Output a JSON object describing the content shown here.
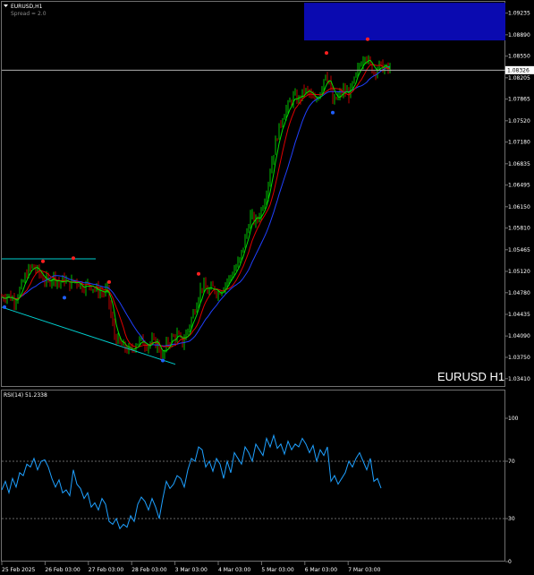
{
  "header": {
    "symbol_label": "EURUSD,H1",
    "spread_label": "Spread = 2.0"
  },
  "watermark": "EURUSD H1",
  "current_price_label": "1.08326",
  "colors": {
    "background": "#000000",
    "bull_candle": "#00c000",
    "bear_candle": "#c00000",
    "fast_ma": "#00e000",
    "mid_ma": "#e00000",
    "slow_ma": "#2040ff",
    "rsi": "#1ea0ff",
    "trendline": "#00d0d0",
    "supply_zone": "#0a0ab0",
    "fractal_up": "#ff2020",
    "fractal_down": "#2060ff"
  },
  "chart_data": [
    {
      "type": "candlestick",
      "symbol": "EURUSD",
      "timeframe": "H1",
      "y_ticks": [
        1.09235,
        1.0889,
        1.0855,
        1.08205,
        1.07865,
        1.0752,
        1.0718,
        1.06835,
        1.06495,
        1.0615,
        1.0581,
        1.05465,
        1.0512,
        1.0478,
        1.04435,
        1.0409,
        1.0375,
        1.0341
      ],
      "ylim": [
        1.0335,
        1.0933
      ],
      "current_price": 1.08326,
      "x_tick_labels": [
        "25 Feb 2025",
        "26 Feb 03:00",
        "27 Feb 03:00",
        "28 Feb 03:00",
        "3 Mar 03:00",
        "4 Mar 03:00",
        "5 Mar 03:00",
        "6 Mar 03:00",
        "7 Mar 03:00"
      ],
      "close_path": [
        [
          0,
          1.047
        ],
        [
          8,
          1.0475
        ],
        [
          16,
          1.0466
        ],
        [
          24,
          1.0488
        ],
        [
          30,
          1.051
        ],
        [
          36,
          1.052
        ],
        [
          42,
          1.0512
        ],
        [
          48,
          1.05
        ],
        [
          54,
          1.0495
        ],
        [
          60,
          1.0505
        ],
        [
          66,
          1.0492
        ],
        [
          72,
          1.05
        ],
        [
          76,
          1.049
        ],
        [
          84,
          1.0498
        ],
        [
          92,
          1.0488
        ],
        [
          100,
          1.0492
        ],
        [
          108,
          1.0482
        ],
        [
          116,
          1.0478
        ],
        [
          120,
          1.0482
        ],
        [
          124,
          1.044
        ],
        [
          128,
          1.041
        ],
        [
          134,
          1.0395
        ],
        [
          140,
          1.039
        ],
        [
          146,
          1.0384
        ],
        [
          152,
          1.0398
        ],
        [
          158,
          1.0402
        ],
        [
          164,
          1.0395
        ],
        [
          170,
          1.04
        ],
        [
          176,
          1.0396
        ],
        [
          182,
          1.0374
        ],
        [
          186,
          1.0395
        ],
        [
          192,
          1.0405
        ],
        [
          198,
          1.041
        ],
        [
          204,
          1.0398
        ],
        [
          210,
          1.042
        ],
        [
          216,
          1.0445
        ],
        [
          222,
          1.0475
        ],
        [
          226,
          1.049
        ],
        [
          232,
          1.048
        ],
        [
          238,
          1.0485
        ],
        [
          244,
          1.0478
        ],
        [
          250,
          1.049
        ],
        [
          256,
          1.05
        ],
        [
          262,
          1.0515
        ],
        [
          268,
          1.053
        ],
        [
          274,
          1.0565
        ],
        [
          280,
          1.06
        ],
        [
          286,
          1.059
        ],
        [
          292,
          1.061
        ],
        [
          298,
          1.064
        ],
        [
          304,
          1.069
        ],
        [
          310,
          1.073
        ],
        [
          316,
          1.076
        ],
        [
          322,
          1.0775
        ],
        [
          328,
          1.079
        ],
        [
          334,
          1.0785
        ],
        [
          340,
          1.08
        ],
        [
          346,
          1.0795
        ],
        [
          352,
          1.078
        ],
        [
          358,
          1.08
        ],
        [
          364,
          1.083
        ],
        [
          368,
          1.0815
        ],
        [
          372,
          1.078
        ],
        [
          378,
          1.079
        ],
        [
          384,
          1.08
        ],
        [
          390,
          1.0795
        ],
        [
          396,
          1.0815
        ],
        [
          402,
          1.084
        ],
        [
          408,
          1.086
        ],
        [
          412,
          1.0845
        ],
        [
          418,
          1.083
        ],
        [
          424,
          1.084
        ],
        [
          430,
          1.0835
        ],
        [
          436,
          1.0833
        ]
      ],
      "fractals_up": [
        [
          48,
          1.0528
        ],
        [
          82,
          1.0533
        ],
        [
          122,
          1.0495
        ],
        [
          222,
          1.0508
        ],
        [
          365,
          1.086
        ],
        [
          411,
          1.0882
        ]
      ],
      "fractals_down": [
        [
          5,
          1.0455
        ],
        [
          72,
          1.047
        ],
        [
          182,
          1.037
        ],
        [
          372,
          1.0765
        ]
      ],
      "channel_top": [
        [
          2,
          1.0532
        ],
        [
          107,
          1.0532
        ]
      ],
      "trendline": [
        [
          2,
          1.0455
        ],
        [
          196,
          1.0364
        ]
      ],
      "supply_zone": {
        "x": [
          340,
          565
        ],
        "y": [
          1.088,
          1.094
        ]
      }
    },
    {
      "type": "line",
      "title": "RSI(14) 51.2338",
      "ylim": [
        0,
        100
      ],
      "y_ticks": [
        100,
        70,
        30,
        0
      ],
      "levels": [
        70,
        30
      ],
      "x": [
        2,
        6,
        10,
        14,
        18,
        22,
        26,
        30,
        34,
        38,
        42,
        46,
        50,
        54,
        58,
        62,
        66,
        70,
        74,
        78,
        82,
        86,
        90,
        94,
        98,
        102,
        106,
        110,
        114,
        118,
        122,
        126,
        130,
        134,
        138,
        142,
        146,
        150,
        154,
        158,
        162,
        166,
        170,
        174,
        178,
        182,
        186,
        190,
        194,
        198,
        202,
        206,
        210,
        214,
        218,
        222,
        226,
        230,
        234,
        238,
        242,
        246,
        250,
        254,
        258,
        262,
        266,
        270,
        274,
        278,
        282,
        286,
        290,
        294,
        298,
        302,
        306,
        310,
        314,
        318,
        322,
        326,
        330,
        334,
        338,
        342,
        346,
        350,
        354,
        358,
        362,
        366,
        370,
        374,
        378,
        382,
        386,
        390,
        394,
        398,
        402,
        406,
        410,
        414,
        418,
        422,
        426
      ],
      "values": [
        50,
        56,
        48,
        58,
        52,
        62,
        60,
        68,
        66,
        72,
        64,
        70,
        71,
        66,
        58,
        52,
        57,
        48,
        50,
        46,
        64,
        54,
        51,
        44,
        48,
        38,
        41,
        36,
        44,
        40,
        28,
        26,
        30,
        23,
        26,
        24,
        32,
        28,
        40,
        45,
        42,
        36,
        44,
        38,
        30,
        44,
        56,
        51,
        54,
        60,
        58,
        52,
        64,
        72,
        70,
        80,
        78,
        66,
        70,
        63,
        72,
        68,
        58,
        70,
        62,
        76,
        72,
        68,
        80,
        76,
        70,
        82,
        78,
        74,
        86,
        80,
        88,
        79,
        82,
        75,
        84,
        78,
        82,
        80,
        86,
        82,
        76,
        81,
        70,
        78,
        74,
        80,
        56,
        60,
        54,
        58,
        62,
        70,
        66,
        72,
        76,
        70,
        64,
        72,
        56,
        58,
        51.2
      ]
    }
  ]
}
